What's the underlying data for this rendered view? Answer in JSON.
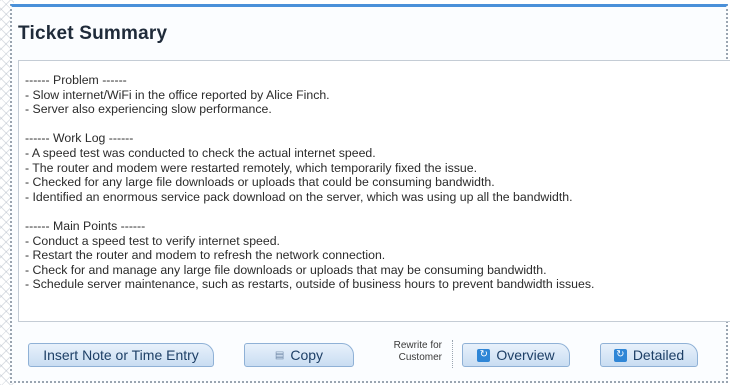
{
  "panel": {
    "title": "Ticket Summary"
  },
  "summary": {
    "problem_header": "------ Problem ------",
    "problem_lines": [
      "- Slow internet/WiFi in the office reported by Alice Finch.",
      "- Server also experiencing slow performance."
    ],
    "worklog_header": "------ Work Log ------",
    "worklog_lines": [
      "- A speed test was conducted to check the actual internet speed.",
      "- The router and modem were restarted remotely, which temporarily fixed the issue.",
      "- Checked for any large file downloads or uploads that could be consuming bandwidth.",
      "- Identified an enormous service pack download on the server, which was using up all the bandwidth."
    ],
    "mainpoints_header": "------ Main Points ------",
    "mainpoints_lines": [
      "- Conduct a speed test to verify internet speed.",
      "- Restart the router and modem to refresh the network connection.",
      "- Check for and manage any large file downloads or uploads that may be consuming bandwidth.",
      "- Schedule server maintenance, such as restarts, outside of business hours to prevent bandwidth issues."
    ]
  },
  "buttons": {
    "insert_note": "Insert Note or Time Entry",
    "copy": "Copy",
    "copy_icon": "document-icon",
    "rewrite_label_line1": "Rewrite for",
    "rewrite_label_line2": "Customer",
    "overview": "Overview",
    "detailed": "Detailed",
    "rewrite_icon": "sync-icon"
  },
  "colors": {
    "accent": "#4a90d9",
    "button_text": "#1d3f66",
    "icon_blue": "#2f86d6"
  }
}
